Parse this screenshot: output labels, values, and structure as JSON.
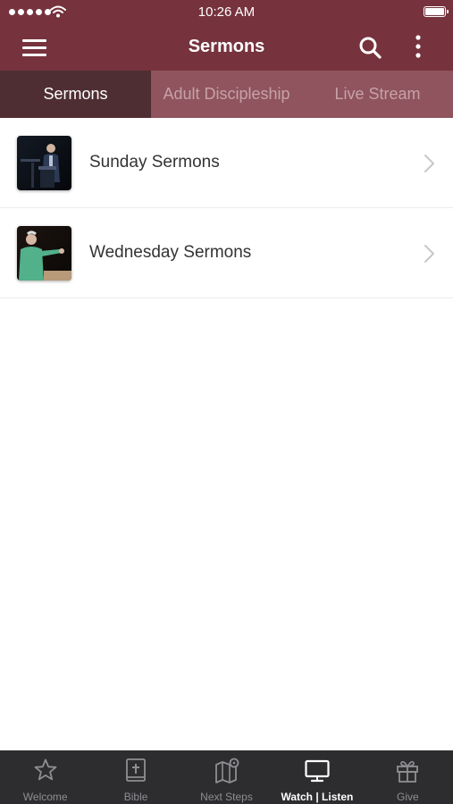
{
  "status_bar": {
    "time": "10:26 AM"
  },
  "header": {
    "title": "Sermons"
  },
  "tabs": [
    {
      "label": "Sermons",
      "active": true
    },
    {
      "label": "Adult Discipleship",
      "active": false
    },
    {
      "label": "Live Stream",
      "active": false
    }
  ],
  "list": {
    "items": [
      {
        "label": "Sunday Sermons",
        "thumbnail": "preacher-at-pulpit-photo"
      },
      {
        "label": "Wednesday Sermons",
        "thumbnail": "preacher-teaching-photo"
      }
    ]
  },
  "tab_bar": {
    "items": [
      {
        "label": "Welcome",
        "icon": "star-icon",
        "active": false
      },
      {
        "label": "Bible",
        "icon": "bible-icon",
        "active": false
      },
      {
        "label": "Next Steps",
        "icon": "map-icon",
        "active": false
      },
      {
        "label": "Watch | Listen",
        "icon": "tv-icon",
        "active": true
      },
      {
        "label": "Give",
        "icon": "gift-icon",
        "active": false
      }
    ]
  },
  "colors": {
    "header_bg": "#76333d",
    "tabs_bg": "#8f545d",
    "active_tab_bg": "#4f2e33",
    "tab_bar_bg": "#2d2d2f"
  }
}
